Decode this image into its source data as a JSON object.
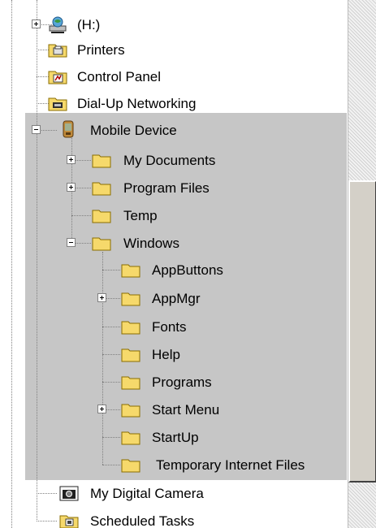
{
  "tree": {
    "items": [
      {
        "label": "(H:)",
        "icon": "network-drive-icon",
        "expander": "plus",
        "selected": false
      },
      {
        "label": "Printers",
        "icon": "printers-folder-icon",
        "expander": null,
        "selected": false
      },
      {
        "label": "Control Panel",
        "icon": "control-panel-icon",
        "expander": null,
        "selected": false
      },
      {
        "label": "Dial-Up Networking",
        "icon": "dialup-networking-icon",
        "expander": null,
        "selected": false
      },
      {
        "label": "Mobile Device",
        "icon": "mobile-device-icon",
        "expander": "minus",
        "selected": true
      },
      {
        "label": "My Documents",
        "icon": "folder-icon",
        "expander": "plus",
        "selected": false
      },
      {
        "label": "Program Files",
        "icon": "folder-icon",
        "expander": "plus",
        "selected": false
      },
      {
        "label": "Temp",
        "icon": "folder-icon",
        "expander": null,
        "selected": false
      },
      {
        "label": "Windows",
        "icon": "folder-open-icon",
        "expander": "minus",
        "selected": false
      },
      {
        "label": "AppButtons",
        "icon": "folder-icon",
        "expander": null,
        "selected": false
      },
      {
        "label": "AppMgr",
        "icon": "folder-icon",
        "expander": "plus",
        "selected": false
      },
      {
        "label": "Fonts",
        "icon": "folder-icon",
        "expander": null,
        "selected": false
      },
      {
        "label": "Help",
        "icon": "folder-icon",
        "expander": null,
        "selected": false
      },
      {
        "label": "Programs",
        "icon": "folder-icon",
        "expander": null,
        "selected": false
      },
      {
        "label": "Start Menu",
        "icon": "folder-icon",
        "expander": "plus",
        "selected": false
      },
      {
        "label": "StartUp",
        "icon": "folder-icon",
        "expander": null,
        "selected": false
      },
      {
        "label": "Temporary Internet Files",
        "icon": "folder-icon",
        "expander": null,
        "selected": false
      },
      {
        "label": "My Digital Camera",
        "icon": "digital-camera-icon",
        "expander": null,
        "selected": false
      },
      {
        "label": "Scheduled Tasks",
        "icon": "scheduled-tasks-icon",
        "expander": null,
        "selected": false
      }
    ]
  },
  "colors": {
    "selection_background": "#c6c6c6",
    "folder_yellow": "#f6d96b",
    "tree_lines": "#808080"
  }
}
